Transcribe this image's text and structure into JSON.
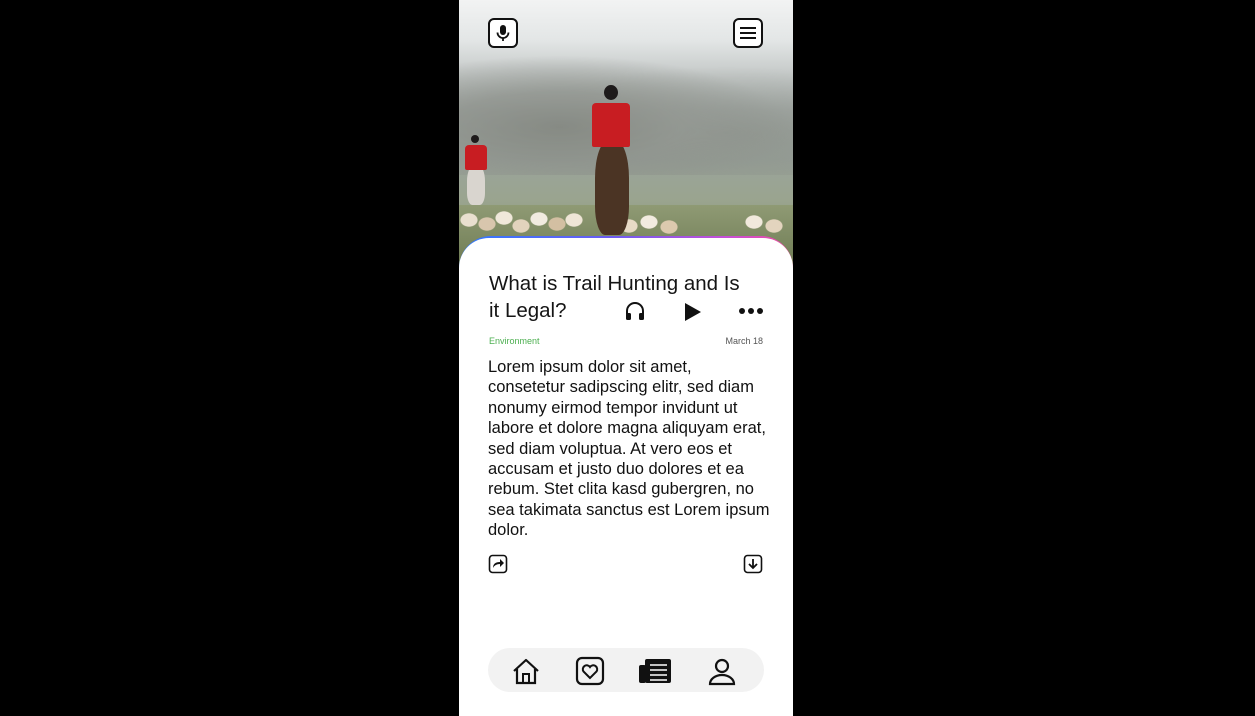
{
  "article": {
    "title": "What is Trail Hunting and Is it Legal?",
    "category": "Environment",
    "date": "March 18",
    "body": "Lorem ipsum dolor sit amet, consetetur sadipscing elitr, sed diam nonumy eirmod tempor invidunt ut labore et dolore magna aliquyam erat, sed diam voluptua. At vero eos et accusam et justo duo dolores et ea rebum. Stet clita kasd gubergren, no sea takimata sanctus est Lorem ipsum dolor."
  },
  "top_bar": {
    "left_icon": "microphone-icon",
    "right_icon": "menu-icon"
  },
  "actions": {
    "audio_icon": "headphones-icon",
    "play_icon": "play-icon",
    "more_icon": "more-icon",
    "share_icon": "share-icon",
    "download_icon": "download-icon"
  },
  "bottom_nav": {
    "items": [
      {
        "icon": "home-icon"
      },
      {
        "icon": "heart-icon"
      },
      {
        "icon": "news-icon"
      },
      {
        "icon": "profile-icon"
      }
    ]
  },
  "colors": {
    "category": "#4caf50",
    "coat": "#c81d22",
    "card_gradient": [
      "#2f7bff",
      "#6a5cf2",
      "#c64fd6",
      "#ee4d9c"
    ]
  }
}
